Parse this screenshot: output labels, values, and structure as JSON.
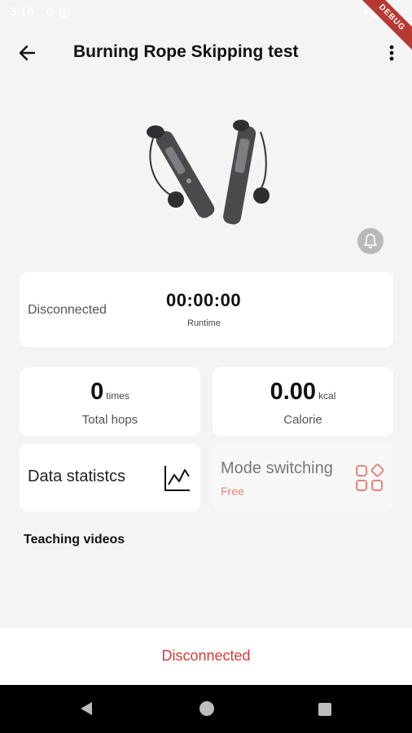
{
  "status_bar": {
    "time": "3:16",
    "left_icons": "⚙ ◫",
    "right_icons": "▾◢▮"
  },
  "debug_banner": "DEBUG",
  "app_bar": {
    "title": "Burning Rope Skipping test"
  },
  "runtime_card": {
    "status": "Disconnected",
    "runtime": "00:00:00",
    "runtime_label": "Runtime"
  },
  "hops": {
    "value": "0",
    "unit": "times",
    "label": "Total hops"
  },
  "calorie": {
    "value": "0.00",
    "unit": "kcal",
    "label": "Calorie"
  },
  "stats": {
    "label": "Data statistcs"
  },
  "mode": {
    "label": "Mode switching",
    "current": "Free"
  },
  "teaching": {
    "heading": "Teaching videos"
  },
  "bottom": {
    "connection_button": "Disconnected"
  },
  "colors": {
    "accent_red": "#d93b32",
    "mode_sub": "#e8847a",
    "background": "#f4f4f4"
  },
  "icons": [
    "back-arrow-icon",
    "more-vert-icon",
    "bell-icon",
    "line-chart-icon",
    "apps-grid-icon",
    "nav-back-icon",
    "nav-home-icon",
    "nav-recents-icon"
  ]
}
